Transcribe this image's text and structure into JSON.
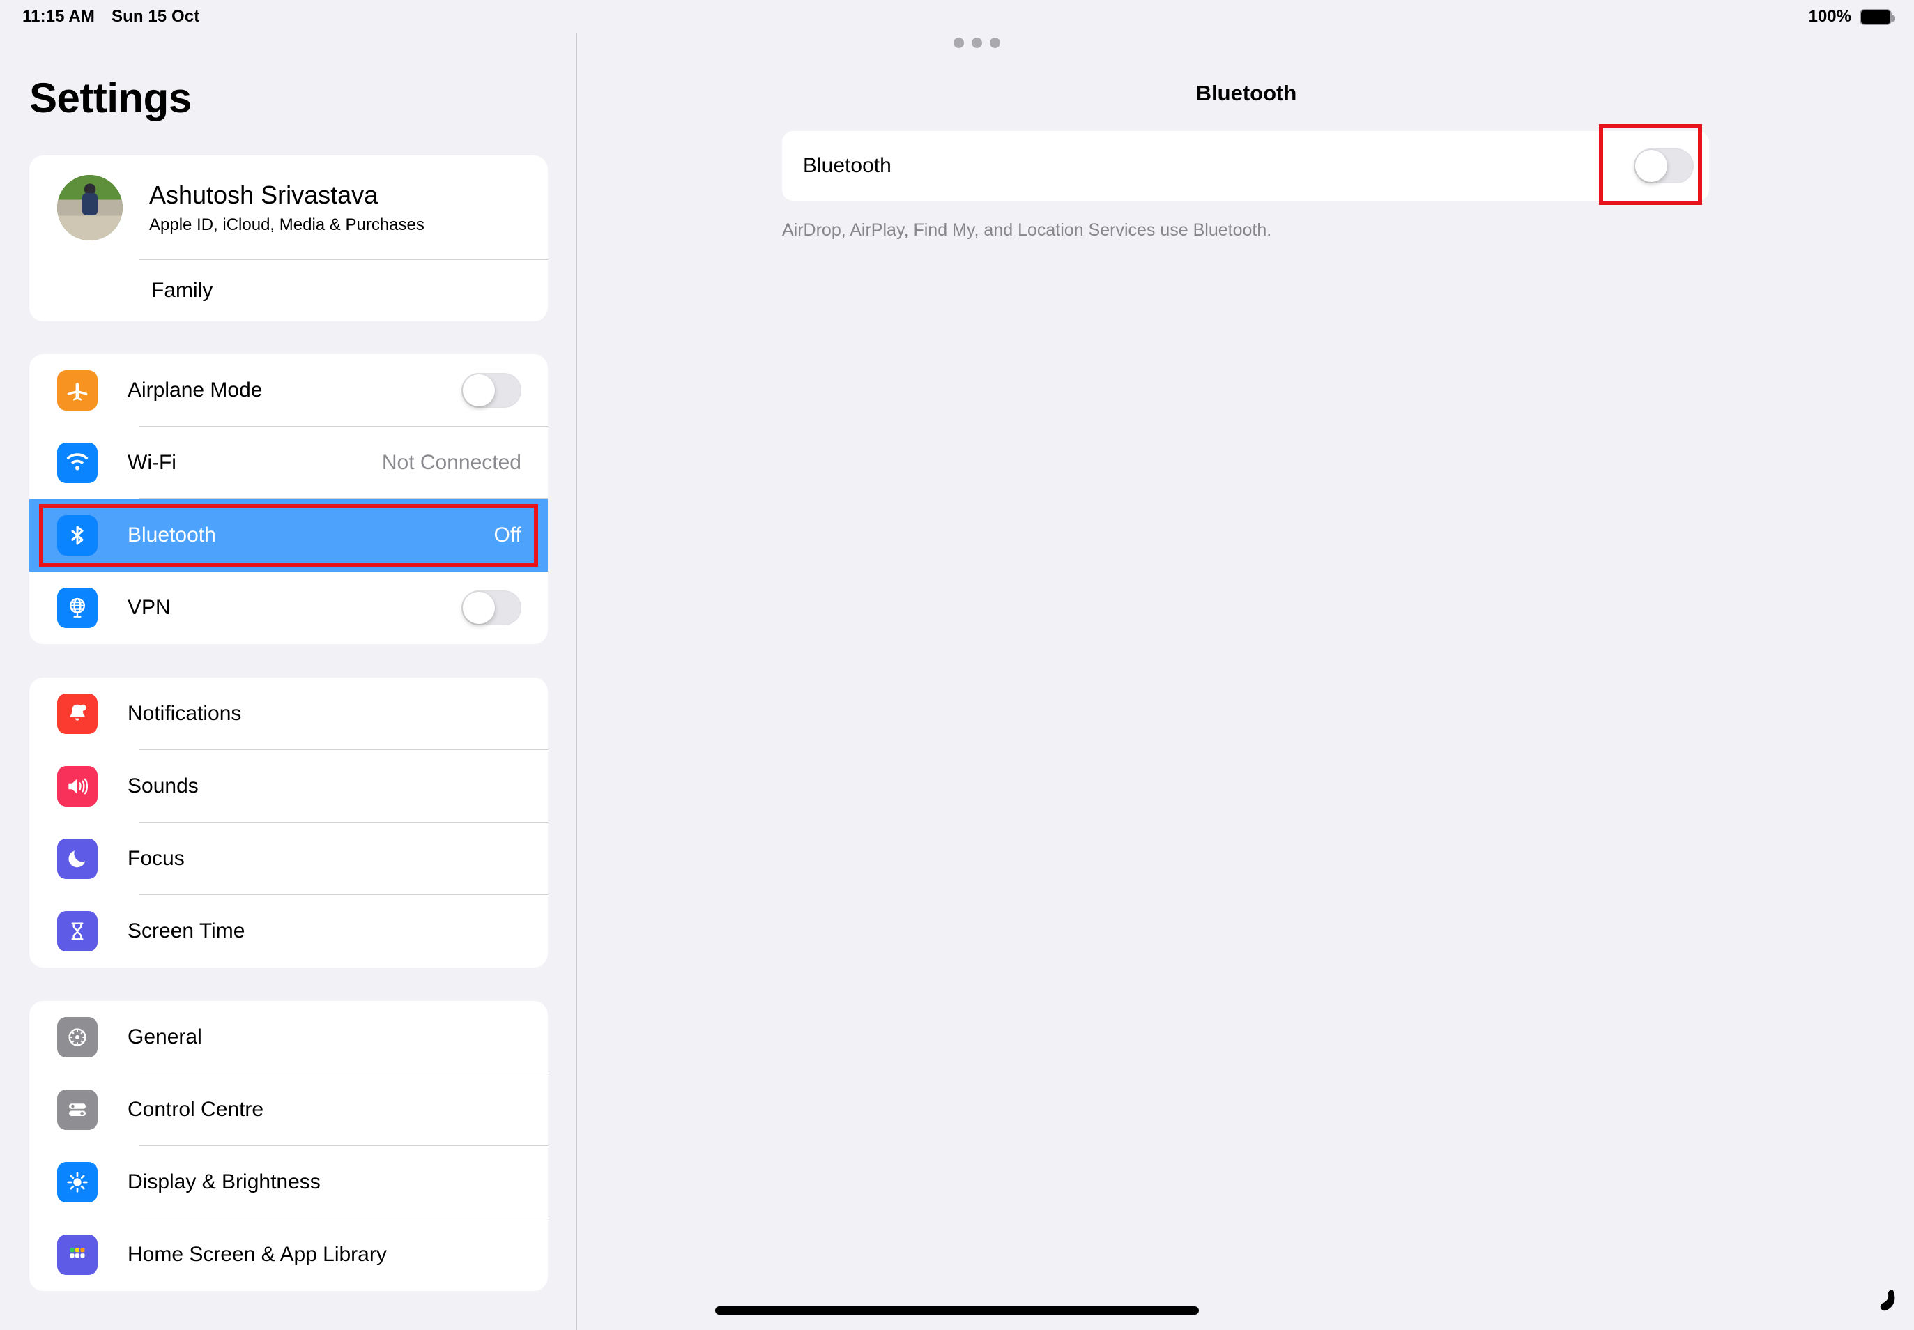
{
  "statusbar": {
    "time": "11:15 AM",
    "date": "Sun 15 Oct",
    "battery_percent": "100%"
  },
  "sidebar": {
    "title": "Settings",
    "profile": {
      "name": "Ashutosh Srivastava",
      "subtitle": "Apple ID, iCloud, Media & Purchases",
      "family_label": "Family"
    },
    "groups": [
      {
        "name": "connectivity",
        "rows": [
          {
            "label": "Airplane Mode",
            "icon": "airplane-icon",
            "control": "toggle",
            "toggle_on": false,
            "value": ""
          },
          {
            "label": "Wi-Fi",
            "icon": "wifi-icon",
            "control": "value",
            "value": "Not Connected"
          },
          {
            "label": "Bluetooth",
            "icon": "bluetooth-icon",
            "control": "value",
            "value": "Off",
            "selected": true
          },
          {
            "label": "VPN",
            "icon": "vpn-globe-icon",
            "control": "toggle",
            "toggle_on": false,
            "value": ""
          }
        ]
      },
      {
        "name": "notifications",
        "rows": [
          {
            "label": "Notifications",
            "icon": "bell-icon",
            "control": "none",
            "value": ""
          },
          {
            "label": "Sounds",
            "icon": "speaker-icon",
            "control": "none",
            "value": ""
          },
          {
            "label": "Focus",
            "icon": "moon-icon",
            "control": "none",
            "value": ""
          },
          {
            "label": "Screen Time",
            "icon": "hourglass-icon",
            "control": "none",
            "value": ""
          }
        ]
      },
      {
        "name": "general",
        "rows": [
          {
            "label": "General",
            "icon": "gear-icon",
            "control": "none",
            "value": ""
          },
          {
            "label": "Control Centre",
            "icon": "control-centre-icon",
            "control": "none",
            "value": ""
          },
          {
            "label": "Display & Brightness",
            "icon": "brightness-icon",
            "control": "none",
            "value": ""
          },
          {
            "label": "Home Screen & App Library",
            "icon": "home-screen-icon",
            "control": "none",
            "value": ""
          }
        ]
      }
    ]
  },
  "detail": {
    "title": "Bluetooth",
    "row_label": "Bluetooth",
    "toggle_on": false,
    "footer": "AirDrop, AirPlay, Find My, and Location Services use Bluetooth."
  },
  "colors": {
    "selection_blue": "#4da2fc",
    "annotation_red": "#e8131b",
    "page_background": "#f2f1f6",
    "card_background": "#ffffff",
    "secondary_text": "#8a8a8e",
    "icon_orange": "#f79421",
    "icon_blue": "#0a84ff",
    "icon_red": "#fb3b30",
    "icon_pink": "#f8315a",
    "icon_purple": "#5e5ce6",
    "icon_gray": "#8e8e93"
  }
}
